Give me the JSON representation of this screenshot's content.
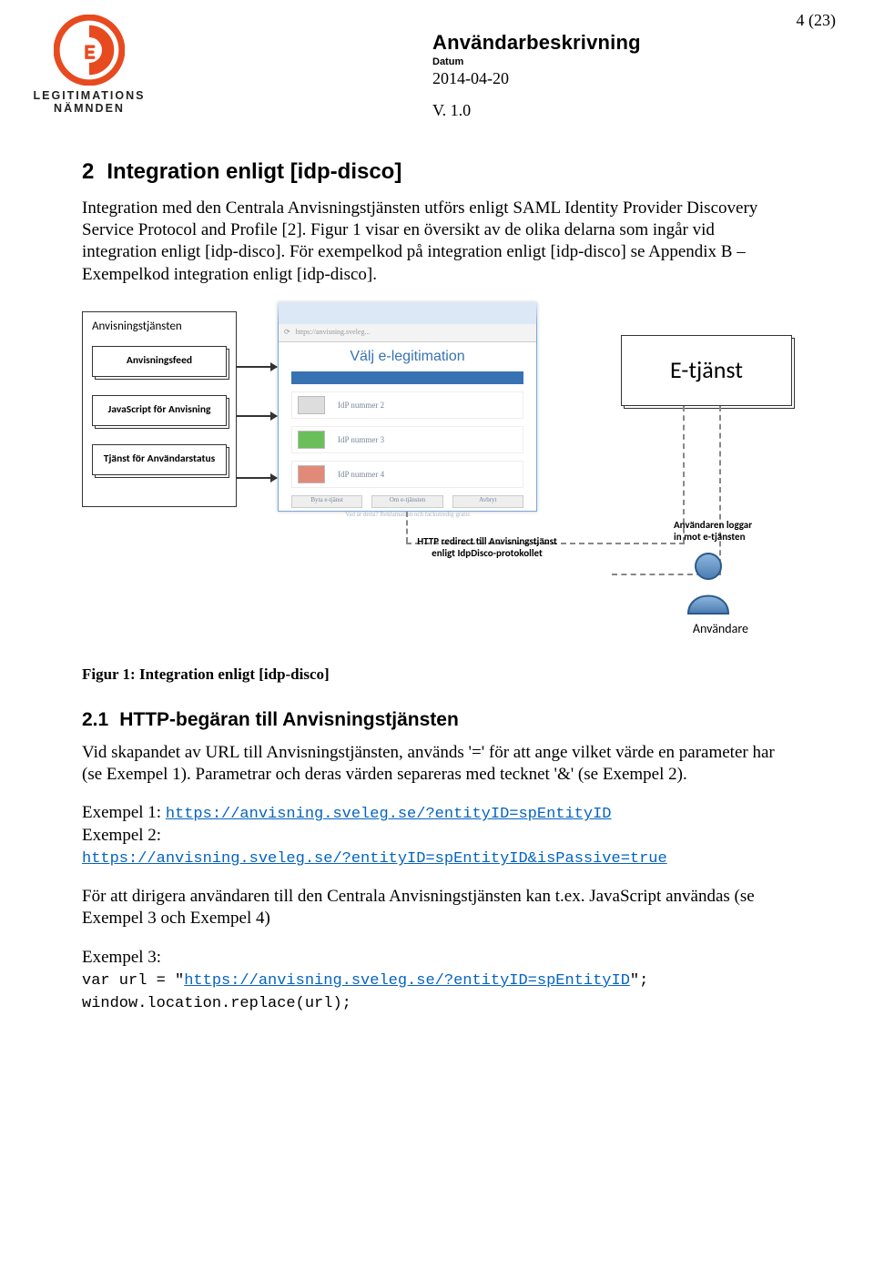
{
  "page_number": "4 (23)",
  "logo": {
    "line1": "LEGITIMATIONS",
    "line2": "NÄMNDEN"
  },
  "header": {
    "title": "Användarbeskrivning",
    "datum_label": "Datum",
    "datum_value": "2014-04-20",
    "version": "V. 1.0"
  },
  "section2": {
    "num": "2",
    "title": "Integration enligt [idp-disco]",
    "para": "Integration med den Centrala Anvisningstjänsten utförs enligt SAML Identity Provider Discovery Service Protocol and Profile [2]. Figur 1 visar en översikt av de olika delarna som ingår vid integration enligt [idp-disco]. För exempelkod på integration enligt [idp-disco] se Appendix B – Exempelkod integration enligt [idp-disco]."
  },
  "diagram": {
    "anv_title": "Anvisningstjänsten",
    "boxes": {
      "feed": "Anvisningsfeed",
      "js": "JavaScript för Anvisning",
      "status": "Tjänst för Användarstatus"
    },
    "browser": {
      "valj": "Välj e-legitimation",
      "rows": [
        "IdP nummer 2",
        "IdP nummer 3",
        "IdP nummer 4"
      ],
      "btns": [
        "Byta e-tjänst",
        "Om e-tjänsten",
        "Avbryt"
      ],
      "tiny": "Vad är detta? Reklamation och fackutredig gratis"
    },
    "etjanst": "E-tjänst",
    "http_label_l1": "HTTP redirect till Anvisningstjänst",
    "http_label_l2": "enligt IdpDisco-protokollet",
    "user_label_l1": "Användaren loggar",
    "user_label_l2": "in mot e-tjänsten",
    "user_name": "Användare"
  },
  "fig_caption": "Figur 1: Integration enligt [idp-disco]",
  "section21": {
    "num": "2.1",
    "title": "HTTP-begäran till Anvisningstjänsten",
    "para": "Vid skapandet av URL till Anvisningstjänsten, används '=' för att ange vilket värde en parameter har (se Exempel 1). Parametrar och deras värden separeras med tecknet '&' (se Exempel 2).",
    "ex1_label": "Exempel 1: ",
    "ex1_url": "https://anvisning.sveleg.se/?entityID=spEntityID",
    "ex2_label": "Exempel 2:",
    "ex2_url": "https://anvisning.sveleg.se/?entityID=spEntityID&isPassive=true",
    "para2": "För att dirigera användaren till den Centrala Anvisningstjänsten kan t.ex. JavaScript användas (se Exempel 3 och Exempel 4)",
    "ex3_label": "Exempel 3:",
    "ex3_line1a": "var url = \"",
    "ex3_url": "https://anvisning.sveleg.se/?entityID=spEntityID",
    "ex3_line1b": "\";",
    "ex3_line2": "window.location.replace(url);"
  }
}
